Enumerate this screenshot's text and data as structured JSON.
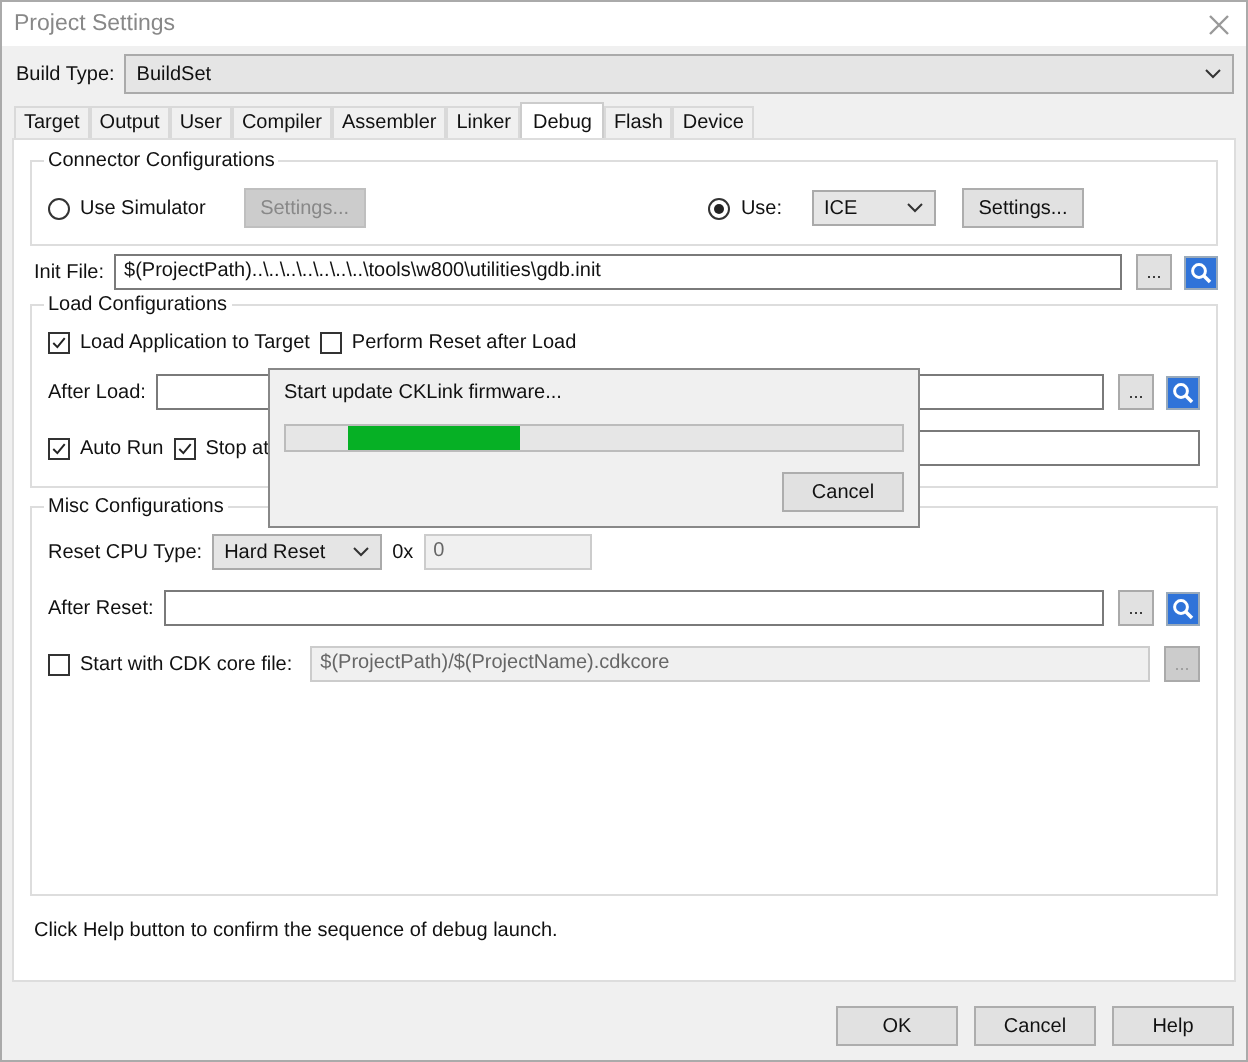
{
  "window": {
    "title": "Project Settings"
  },
  "build_type": {
    "label": "Build Type:",
    "value": "BuildSet"
  },
  "tabs": [
    {
      "label": "Target",
      "selected": false
    },
    {
      "label": "Output",
      "selected": false
    },
    {
      "label": "User",
      "selected": false
    },
    {
      "label": "Compiler",
      "selected": false
    },
    {
      "label": "Assembler",
      "selected": false
    },
    {
      "label": "Linker",
      "selected": false
    },
    {
      "label": "Debug",
      "selected": true
    },
    {
      "label": "Flash",
      "selected": false
    },
    {
      "label": "Device",
      "selected": false
    }
  ],
  "connector": {
    "title": "Connector Configurations",
    "simulator": {
      "label": "Use Simulator",
      "selected": false,
      "button": "Settings...",
      "button_disabled": true
    },
    "use": {
      "label": "Use:",
      "selected": true,
      "value": "ICE",
      "button": "Settings...",
      "button_disabled": false
    }
  },
  "init_file": {
    "label": "Init File:",
    "value": "$(ProjectPath)..\\..\\..\\..\\..\\..\\..\\tools\\w800\\utilities\\gdb.init",
    "browse": "..."
  },
  "load": {
    "title": "Load Configurations",
    "load_app": {
      "label": "Load Application to Target",
      "checked": true
    },
    "perform_reset": {
      "label": "Perform Reset after Load",
      "checked": false
    },
    "after_load": {
      "label": "After Load:",
      "browse": "..."
    },
    "auto_run": {
      "label": "Auto Run",
      "checked": true
    },
    "stop_at": {
      "label": "Stop at",
      "checked": true
    }
  },
  "misc": {
    "title": "Misc Configurations",
    "reset_cpu": {
      "label": "Reset CPU Type:",
      "value": "Hard Reset",
      "prefix": "0x",
      "address": "0",
      "address_disabled": true
    },
    "after_reset": {
      "label": "After Reset:",
      "browse": "..."
    },
    "core_file": {
      "label": "Start with CDK core file:",
      "checked": false,
      "value": "$(ProjectPath)/$(ProjectName).cdkcore",
      "disabled": true,
      "browse": "..."
    }
  },
  "help_text": "Click Help button to confirm the sequence of debug launch.",
  "buttons": [
    "OK",
    "Cancel",
    "Help"
  ],
  "progress_dialog": {
    "message": "Start update CKLink firmware...",
    "level": 0.28,
    "button": "Cancel"
  }
}
